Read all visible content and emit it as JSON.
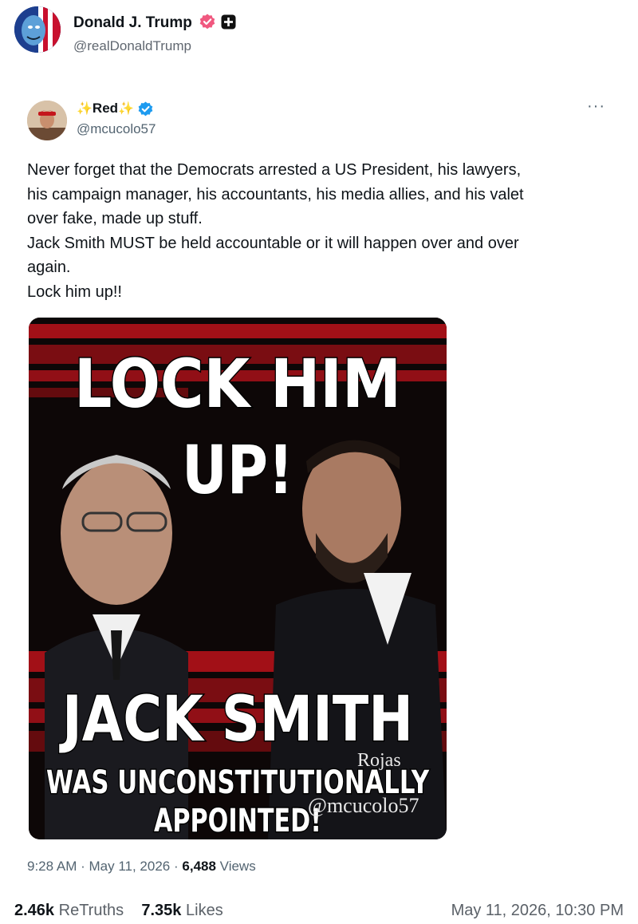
{
  "post": {
    "author_name": "Donald J. Trump",
    "author_handle": "@realDonaldTrump"
  },
  "embedded": {
    "author_name": "Red",
    "author_handle": "@mcucolo57",
    "more_label": "···",
    "text_lines": [
      "Never forget that the Democrats arrested a US President, his lawyers,",
      "his campaign manager, his accountants, his media allies, and his valet",
      "over fake, made up stuff.",
      "Jack Smith MUST be held accountable or it will happen over and over",
      "again.",
      "Lock him up!!"
    ],
    "image_text": {
      "line1": "LOCK HIM",
      "line2": "UP!",
      "line3": "JACK SMITH",
      "line4": "WAS UNCONSTITUTIONALLY",
      "line5": "APPOINTED!",
      "watermark1": "Rojas",
      "watermark2": "@mcucolo57"
    },
    "time": "9:28 AM",
    "date": "May 11, 2026",
    "views_count": "6,488",
    "views_label": "Views"
  },
  "footer": {
    "retruths_count": "2.46k",
    "retruths_label": "ReTruths",
    "likes_count": "7.35k",
    "likes_label": "Likes",
    "timestamp": "May 11, 2026, 10:30 PM"
  },
  "colors": {
    "verified_pink": "#f0587f",
    "verified_blue": "#1d9bf0",
    "stripe_red": "#b3121a"
  }
}
